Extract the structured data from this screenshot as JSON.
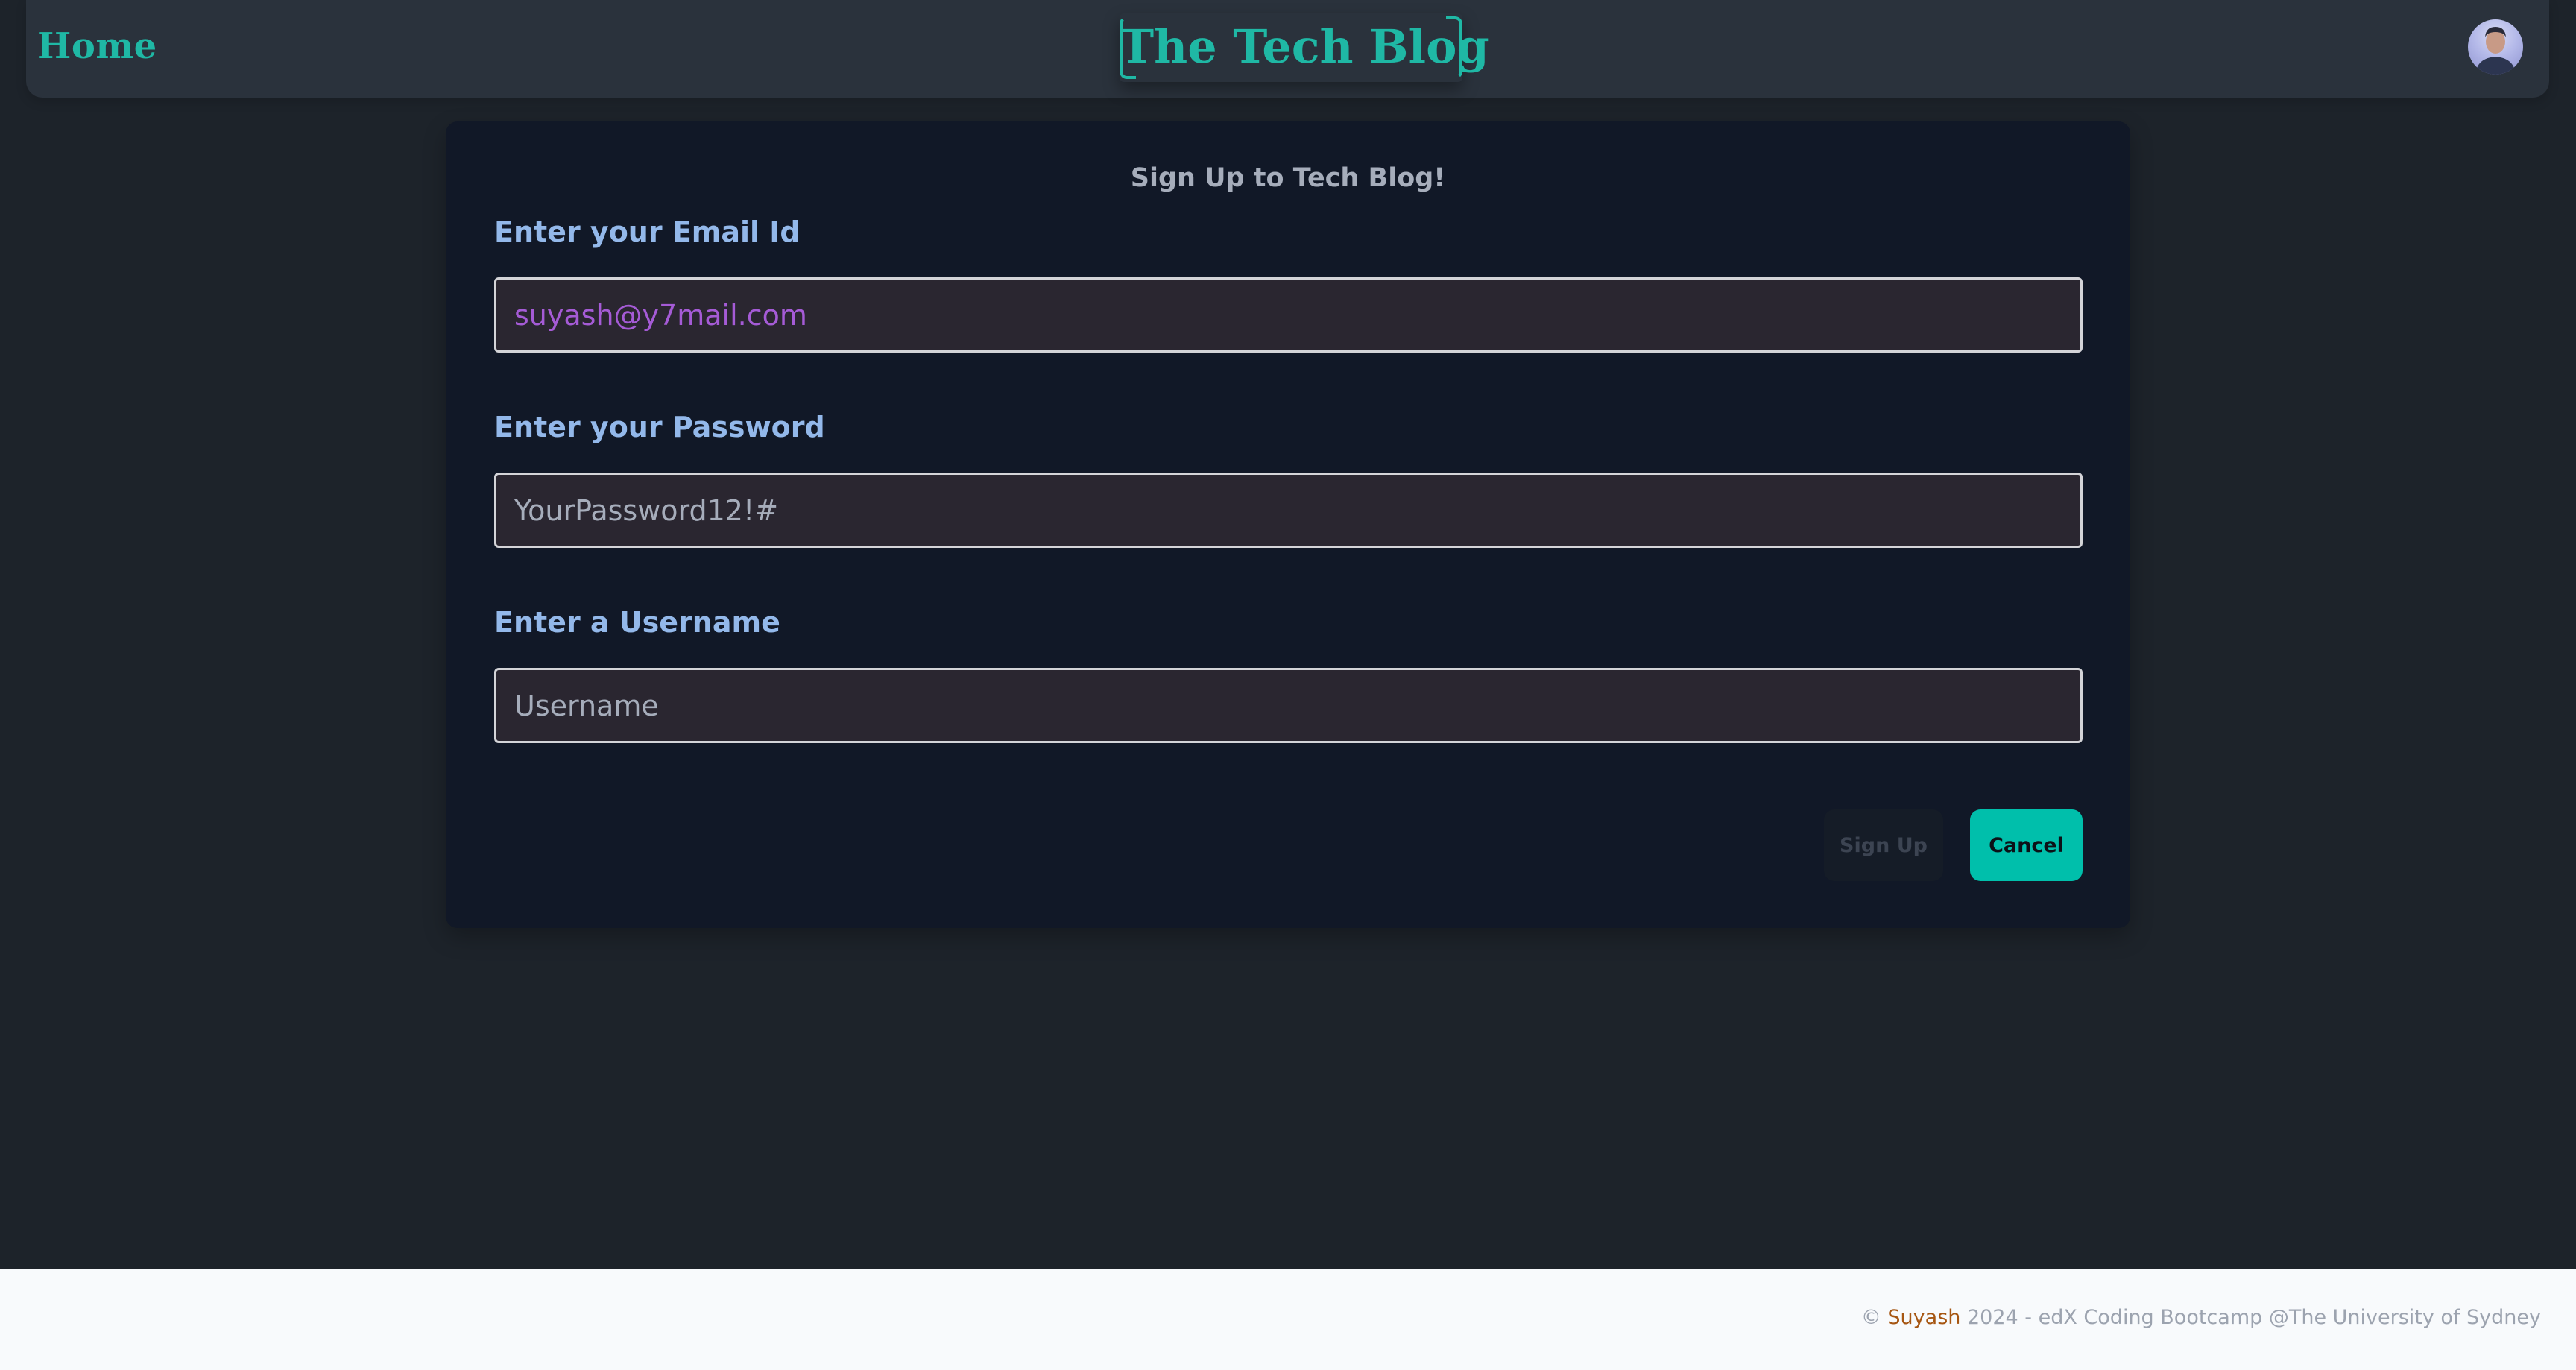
{
  "navbar": {
    "home_label": "Home",
    "brand_title": "The Tech Blog",
    "avatar_icon": "user-avatar"
  },
  "form": {
    "title": "Sign Up to Tech Blog!",
    "email": {
      "label": "Enter your Email Id",
      "value": "suyash@y7mail.com"
    },
    "password": {
      "label": "Enter your Password",
      "placeholder": "YourPassword12!#"
    },
    "username": {
      "label": "Enter a Username",
      "placeholder": "Username"
    },
    "signup_label": "Sign Up",
    "cancel_label": "Cancel"
  },
  "footer": {
    "copyright_symbol": "©",
    "author": "Suyash",
    "text": "2024 - edX Coding Bootcamp @The University of Sydney"
  },
  "colors": {
    "accent": "#1fb8a5",
    "cancel_button": "#00bfab",
    "label": "#93b8ea",
    "email_value": "#a55bd6"
  }
}
